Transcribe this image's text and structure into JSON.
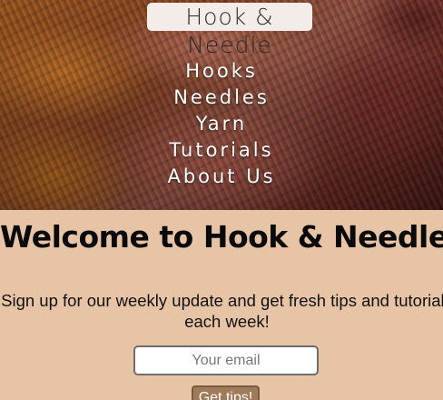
{
  "brand": {
    "logo_text": "Hook & Needle"
  },
  "nav": {
    "items": [
      "Hooks",
      "Needles",
      "Yarn",
      "Tutorials",
      "About Us"
    ]
  },
  "main": {
    "heading": "Welcome to Hook & Needle!",
    "signup_line1": "Sign up for our weekly update and get fresh tips and tutorials",
    "signup_line2": "each week!",
    "email_placeholder": "Your email",
    "submit_label": "Get tips!"
  },
  "colors": {
    "background": "#e8c4a6",
    "button": "#a07b5a"
  }
}
